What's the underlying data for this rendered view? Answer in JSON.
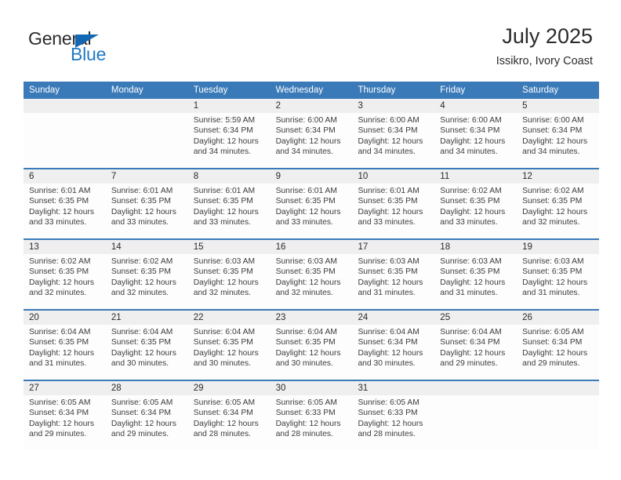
{
  "brand": {
    "name_part1": "General",
    "name_part2": "Blue",
    "triangle_icon": "triangle-icon",
    "accent_color": "#1268b3"
  },
  "header": {
    "title": "July 2025",
    "subtitle": "Issikro, Ivory Coast"
  },
  "calendar": {
    "header_bg": "#3a7ab8",
    "daynum_bg": "#efefef",
    "weekdays": [
      "Sunday",
      "Monday",
      "Tuesday",
      "Wednesday",
      "Thursday",
      "Friday",
      "Saturday"
    ],
    "weeks": [
      [
        {
          "day": "",
          "lines": []
        },
        {
          "day": "",
          "lines": []
        },
        {
          "day": "1",
          "lines": [
            "Sunrise: 5:59 AM",
            "Sunset: 6:34 PM",
            "Daylight: 12 hours",
            "and 34 minutes."
          ]
        },
        {
          "day": "2",
          "lines": [
            "Sunrise: 6:00 AM",
            "Sunset: 6:34 PM",
            "Daylight: 12 hours",
            "and 34 minutes."
          ]
        },
        {
          "day": "3",
          "lines": [
            "Sunrise: 6:00 AM",
            "Sunset: 6:34 PM",
            "Daylight: 12 hours",
            "and 34 minutes."
          ]
        },
        {
          "day": "4",
          "lines": [
            "Sunrise: 6:00 AM",
            "Sunset: 6:34 PM",
            "Daylight: 12 hours",
            "and 34 minutes."
          ]
        },
        {
          "day": "5",
          "lines": [
            "Sunrise: 6:00 AM",
            "Sunset: 6:34 PM",
            "Daylight: 12 hours",
            "and 34 minutes."
          ]
        }
      ],
      [
        {
          "day": "6",
          "lines": [
            "Sunrise: 6:01 AM",
            "Sunset: 6:35 PM",
            "Daylight: 12 hours",
            "and 33 minutes."
          ]
        },
        {
          "day": "7",
          "lines": [
            "Sunrise: 6:01 AM",
            "Sunset: 6:35 PM",
            "Daylight: 12 hours",
            "and 33 minutes."
          ]
        },
        {
          "day": "8",
          "lines": [
            "Sunrise: 6:01 AM",
            "Sunset: 6:35 PM",
            "Daylight: 12 hours",
            "and 33 minutes."
          ]
        },
        {
          "day": "9",
          "lines": [
            "Sunrise: 6:01 AM",
            "Sunset: 6:35 PM",
            "Daylight: 12 hours",
            "and 33 minutes."
          ]
        },
        {
          "day": "10",
          "lines": [
            "Sunrise: 6:01 AM",
            "Sunset: 6:35 PM",
            "Daylight: 12 hours",
            "and 33 minutes."
          ]
        },
        {
          "day": "11",
          "lines": [
            "Sunrise: 6:02 AM",
            "Sunset: 6:35 PM",
            "Daylight: 12 hours",
            "and 33 minutes."
          ]
        },
        {
          "day": "12",
          "lines": [
            "Sunrise: 6:02 AM",
            "Sunset: 6:35 PM",
            "Daylight: 12 hours",
            "and 32 minutes."
          ]
        }
      ],
      [
        {
          "day": "13",
          "lines": [
            "Sunrise: 6:02 AM",
            "Sunset: 6:35 PM",
            "Daylight: 12 hours",
            "and 32 minutes."
          ]
        },
        {
          "day": "14",
          "lines": [
            "Sunrise: 6:02 AM",
            "Sunset: 6:35 PM",
            "Daylight: 12 hours",
            "and 32 minutes."
          ]
        },
        {
          "day": "15",
          "lines": [
            "Sunrise: 6:03 AM",
            "Sunset: 6:35 PM",
            "Daylight: 12 hours",
            "and 32 minutes."
          ]
        },
        {
          "day": "16",
          "lines": [
            "Sunrise: 6:03 AM",
            "Sunset: 6:35 PM",
            "Daylight: 12 hours",
            "and 32 minutes."
          ]
        },
        {
          "day": "17",
          "lines": [
            "Sunrise: 6:03 AM",
            "Sunset: 6:35 PM",
            "Daylight: 12 hours",
            "and 31 minutes."
          ]
        },
        {
          "day": "18",
          "lines": [
            "Sunrise: 6:03 AM",
            "Sunset: 6:35 PM",
            "Daylight: 12 hours",
            "and 31 minutes."
          ]
        },
        {
          "day": "19",
          "lines": [
            "Sunrise: 6:03 AM",
            "Sunset: 6:35 PM",
            "Daylight: 12 hours",
            "and 31 minutes."
          ]
        }
      ],
      [
        {
          "day": "20",
          "lines": [
            "Sunrise: 6:04 AM",
            "Sunset: 6:35 PM",
            "Daylight: 12 hours",
            "and 31 minutes."
          ]
        },
        {
          "day": "21",
          "lines": [
            "Sunrise: 6:04 AM",
            "Sunset: 6:35 PM",
            "Daylight: 12 hours",
            "and 30 minutes."
          ]
        },
        {
          "day": "22",
          "lines": [
            "Sunrise: 6:04 AM",
            "Sunset: 6:35 PM",
            "Daylight: 12 hours",
            "and 30 minutes."
          ]
        },
        {
          "day": "23",
          "lines": [
            "Sunrise: 6:04 AM",
            "Sunset: 6:35 PM",
            "Daylight: 12 hours",
            "and 30 minutes."
          ]
        },
        {
          "day": "24",
          "lines": [
            "Sunrise: 6:04 AM",
            "Sunset: 6:34 PM",
            "Daylight: 12 hours",
            "and 30 minutes."
          ]
        },
        {
          "day": "25",
          "lines": [
            "Sunrise: 6:04 AM",
            "Sunset: 6:34 PM",
            "Daylight: 12 hours",
            "and 29 minutes."
          ]
        },
        {
          "day": "26",
          "lines": [
            "Sunrise: 6:05 AM",
            "Sunset: 6:34 PM",
            "Daylight: 12 hours",
            "and 29 minutes."
          ]
        }
      ],
      [
        {
          "day": "27",
          "lines": [
            "Sunrise: 6:05 AM",
            "Sunset: 6:34 PM",
            "Daylight: 12 hours",
            "and 29 minutes."
          ]
        },
        {
          "day": "28",
          "lines": [
            "Sunrise: 6:05 AM",
            "Sunset: 6:34 PM",
            "Daylight: 12 hours",
            "and 29 minutes."
          ]
        },
        {
          "day": "29",
          "lines": [
            "Sunrise: 6:05 AM",
            "Sunset: 6:34 PM",
            "Daylight: 12 hours",
            "and 28 minutes."
          ]
        },
        {
          "day": "30",
          "lines": [
            "Sunrise: 6:05 AM",
            "Sunset: 6:33 PM",
            "Daylight: 12 hours",
            "and 28 minutes."
          ]
        },
        {
          "day": "31",
          "lines": [
            "Sunrise: 6:05 AM",
            "Sunset: 6:33 PM",
            "Daylight: 12 hours",
            "and 28 minutes."
          ]
        },
        {
          "day": "",
          "lines": []
        },
        {
          "day": "",
          "lines": []
        }
      ]
    ]
  }
}
